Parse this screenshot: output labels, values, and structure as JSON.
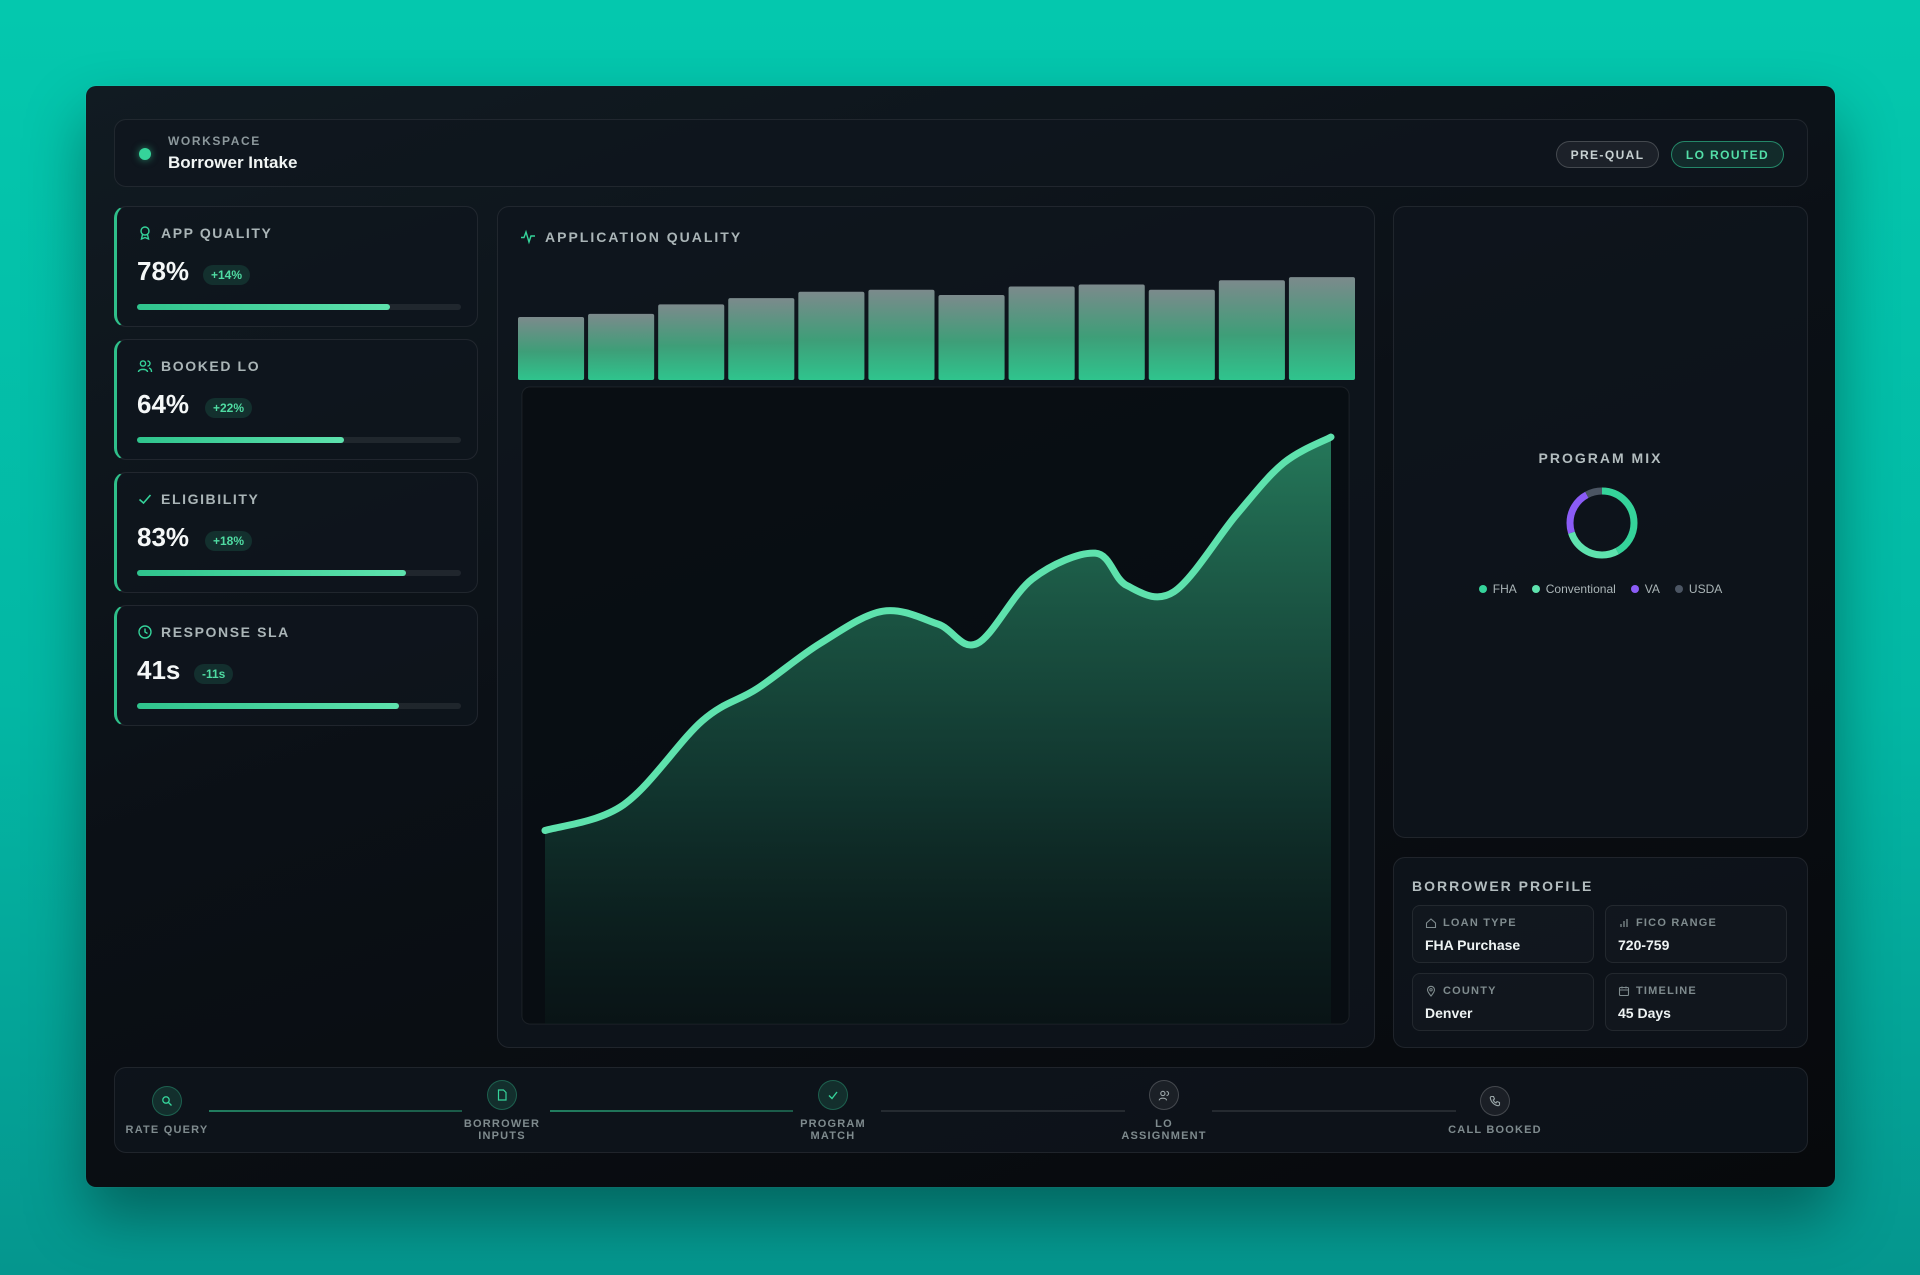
{
  "workspace": {
    "label": "WORKSPACE",
    "title": "Borrower Intake"
  },
  "badges": {
    "prequal": "PRE-QUAL",
    "lo_routed": "LO ROUTED"
  },
  "metrics": [
    {
      "icon": "award-icon",
      "label": "APP QUALITY",
      "value": "78%",
      "delta": "+14%",
      "progress": 0.78
    },
    {
      "icon": "users-icon",
      "label": "BOOKED LO",
      "value": "64%",
      "delta": "+22%",
      "progress": 0.64
    },
    {
      "icon": "check-icon",
      "label": "ELIGIBILITY",
      "value": "83%",
      "delta": "+18%",
      "progress": 0.83
    },
    {
      "icon": "clock-icon",
      "label": "RESPONSE SLA",
      "value": "41s",
      "delta": "-11s",
      "progress": 0.81
    }
  ],
  "chart": {
    "title": "APPLICATION QUALITY",
    "icon": "activity-icon"
  },
  "chart_data": {
    "type": "area",
    "title": "APPLICATION QUALITY",
    "bars": [
      0.6,
      0.63,
      0.72,
      0.78,
      0.84,
      0.86,
      0.81,
      0.89,
      0.91,
      0.86,
      0.95,
      0.98
    ],
    "line": {
      "x": [
        0,
        0.1,
        0.2,
        0.27,
        0.35,
        0.43,
        0.5,
        0.55,
        0.62,
        0.7,
        0.74,
        0.8,
        0.88,
        0.94,
        1.0
      ],
      "y": [
        0.3,
        0.34,
        0.47,
        0.52,
        0.59,
        0.64,
        0.62,
        0.59,
        0.69,
        0.73,
        0.68,
        0.67,
        0.79,
        0.87,
        0.91
      ]
    }
  },
  "program_mix": {
    "title": "PROGRAM MIX",
    "legend": [
      {
        "name": "FHA",
        "color": "#35d39a"
      },
      {
        "name": "Conventional",
        "color": "#5ee2ad"
      },
      {
        "name": "VA",
        "color": "#8b5cf6"
      },
      {
        "name": "USDA",
        "color": "#4b5563"
      }
    ],
    "slices": [
      0.42,
      0.28,
      0.22,
      0.08
    ]
  },
  "profile": {
    "title": "BORROWER PROFILE",
    "fields": [
      {
        "icon": "home-icon",
        "label": "LOAN TYPE",
        "value": "FHA Purchase"
      },
      {
        "icon": "bar-chart-icon",
        "label": "FICO RANGE",
        "value": "720-759"
      },
      {
        "icon": "map-pin-icon",
        "label": "COUNTY",
        "value": "Denver"
      },
      {
        "icon": "calendar-icon",
        "label": "TIMELINE",
        "value": "45 Days"
      }
    ]
  },
  "steps": [
    {
      "label": "RATE QUERY",
      "icon": "search-icon",
      "status": "done"
    },
    {
      "label": "BORROWER\nINPUTS",
      "icon": "file-icon",
      "status": "done"
    },
    {
      "label": "PROGRAM\nMATCH",
      "icon": "check-icon",
      "status": "done"
    },
    {
      "label": "LO\nASSIGNMENT",
      "icon": "users-icon",
      "status": "todo"
    },
    {
      "label": "CALL BOOKED",
      "icon": "phone-icon",
      "status": "todo"
    }
  ]
}
